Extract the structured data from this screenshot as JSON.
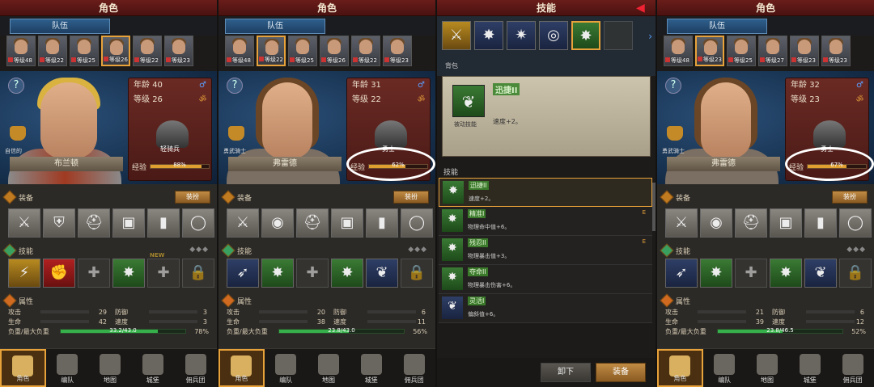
{
  "colors": {
    "title_bar": "#6a1d1a",
    "selected_border": "#e8a23a",
    "team_tab": "#2e5f8c",
    "weight_bar": "#36b04a",
    "annotation": "#ffffff"
  },
  "panels": [
    {
      "title": "角色",
      "team_tab": "队伍",
      "portraits": [
        {
          "level": "等级48",
          "selected": false
        },
        {
          "level": "等级22",
          "selected": false
        },
        {
          "level": "等级25",
          "selected": false
        },
        {
          "level": "等级26",
          "selected": true
        },
        {
          "level": "等级22",
          "selected": false
        },
        {
          "level": "等级23",
          "selected": false
        }
      ],
      "trait": "自信的",
      "hero_name": "布兰顿",
      "age_label": "年龄",
      "age": "40",
      "level_label": "等级",
      "level": "26",
      "unit_name": "轻骑兵",
      "exp_label": "经验",
      "exp_text": "88%",
      "exp_fraction": 0.88,
      "equip_label": "装备",
      "dress_button": "装扮",
      "skill_label": "技能",
      "skill_dots": "◆◆◆",
      "new_badge": "NEW",
      "attr_label": "属性",
      "attack_label": "攻击",
      "attack": "29",
      "defense_label": "防御",
      "defense": "3",
      "hp_label": "生命",
      "hp": "42",
      "speed_label": "速度",
      "speed": "3",
      "weight_label": "负重/最大负重",
      "weight_text": "33.2/43.0",
      "weight_pct": "78%",
      "weight_fraction": 0.78
    },
    {
      "title": "角色",
      "team_tab": "队伍",
      "portraits": [
        {
          "level": "等级48",
          "selected": false
        },
        {
          "level": "等级22",
          "selected": true
        },
        {
          "level": "等级25",
          "selected": false
        },
        {
          "level": "等级26",
          "selected": false
        },
        {
          "level": "等级22",
          "selected": false
        },
        {
          "level": "等级23",
          "selected": false
        }
      ],
      "trait": "勇武骑士",
      "hero_name": "弗雷德",
      "age_label": "年龄",
      "age": "31",
      "level_label": "等级",
      "level": "22",
      "unit_name": "勇士",
      "exp_label": "经验",
      "exp_text": "62%",
      "exp_fraction": 0.62,
      "equip_label": "装备",
      "dress_button": "装扮",
      "skill_label": "技能",
      "skill_dots": "◆◆◆",
      "attr_label": "属性",
      "attack_label": "攻击",
      "attack": "20",
      "defense_label": "防御",
      "defense": "6",
      "hp_label": "生命",
      "hp": "38",
      "speed_label": "速度",
      "speed": "11",
      "weight_label": "负重/最大负重",
      "weight_text": "23.8/43.0",
      "weight_pct": "56%",
      "weight_fraction": 0.56
    },
    {
      "title": "技能",
      "back_label": "背包",
      "selected_skill": {
        "name": "迅捷II",
        "type": "被动技能",
        "desc": "速度+2。"
      },
      "skills_label": "技能",
      "skill_list": [
        {
          "name": "迅捷II",
          "desc": "速度+2。",
          "tag": "",
          "selected": true
        },
        {
          "name": "精准I",
          "desc": "物理命中值+6。",
          "tag": "E",
          "selected": false
        },
        {
          "name": "残忍II",
          "desc": "物理暴击值+3。",
          "tag": "E",
          "selected": false
        },
        {
          "name": "夺命II",
          "desc": "物理暴击伤害+6。",
          "tag": "",
          "selected": false
        },
        {
          "name": "灵活I",
          "desc": "偏斜值+6。",
          "tag": "",
          "selected": false
        }
      ],
      "unload_button": "卸下",
      "equip_button": "装备"
    },
    {
      "title": "角色",
      "team_tab": "队伍",
      "portraits": [
        {
          "level": "等级48",
          "selected": false
        },
        {
          "level": "等级23",
          "selected": true
        },
        {
          "level": "等级25",
          "selected": false
        },
        {
          "level": "等级27",
          "selected": false
        },
        {
          "level": "等级23",
          "selected": false
        },
        {
          "level": "等级23",
          "selected": false
        }
      ],
      "trait": "勇武骑士",
      "hero_name": "弗雷德",
      "age_label": "年龄",
      "age": "32",
      "level_label": "等级",
      "level": "23",
      "unit_name": "勇士",
      "exp_label": "经验",
      "exp_text": "67%",
      "exp_fraction": 0.67,
      "equip_label": "装备",
      "dress_button": "装扮",
      "skill_label": "技能",
      "skill_dots": "◆◆◆",
      "attr_label": "属性",
      "attack_label": "攻击",
      "attack": "21",
      "defense_label": "防御",
      "defense": "6",
      "hp_label": "生命",
      "hp": "39",
      "speed_label": "速度",
      "speed": "12",
      "weight_label": "负重/最大负重",
      "weight_text": "23.8/46.5",
      "weight_pct": "52%",
      "weight_fraction": 0.52
    }
  ],
  "nav": [
    {
      "label": "角色",
      "icon": "character-icon"
    },
    {
      "label": "编队",
      "icon": "formation-icon"
    },
    {
      "label": "地图",
      "icon": "map-icon"
    },
    {
      "label": "城堡",
      "icon": "castle-icon"
    },
    {
      "label": "佣兵团",
      "icon": "mercenary-icon"
    }
  ],
  "icons": {
    "equipment_p1": [
      "sword-icon",
      "shield-icon",
      "helmet-icon",
      "armor-icon",
      "boots-icon",
      "ring-icon"
    ],
    "equipment_p2": [
      "sword-icon",
      "round-shield-icon",
      "helmet-icon",
      "armor-icon",
      "boots-icon",
      "ring-icon"
    ],
    "skills_p1": [
      "charge-skill-icon",
      "strike-skill-icon",
      "empty-slot-icon",
      "burst-skill-icon",
      "empty-slot-icon",
      "lock-icon"
    ],
    "skills_p2": [
      "lance-skill-icon",
      "burst-skill-icon",
      "empty-slot-icon",
      "burst-skill-icon",
      "swift-skill-icon",
      "lock-icon"
    ]
  }
}
